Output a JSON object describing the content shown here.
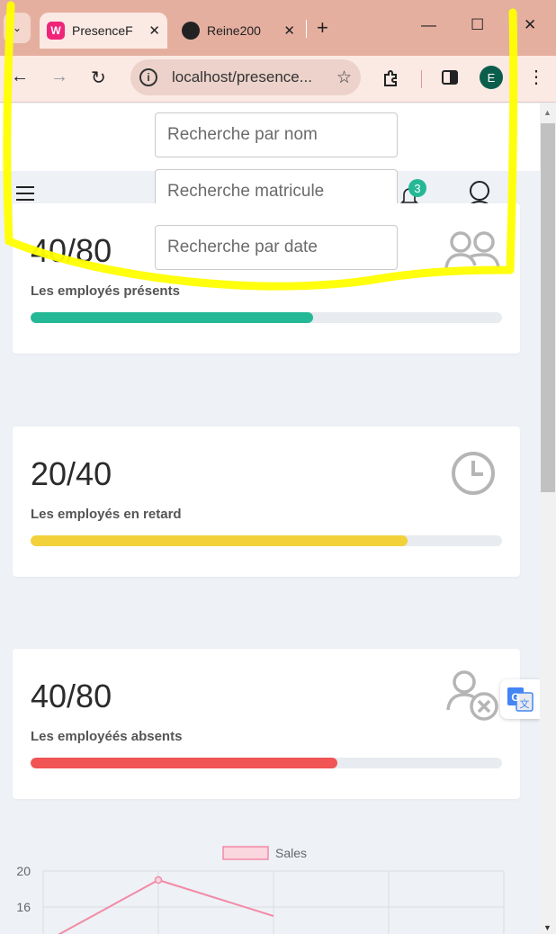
{
  "browser": {
    "tabs": [
      {
        "title": "PresenceF",
        "close": "✕"
      },
      {
        "title": "Reine200",
        "close": "✕"
      }
    ],
    "new_tab": "+",
    "window": {
      "minimize": "—",
      "maximize": "☐",
      "close": "✕"
    },
    "url": "localhost/presence...",
    "profile_initial": "E",
    "wasm_fav": "W"
  },
  "search": {
    "name_placeholder": "Recherche par nom",
    "matricule_placeholder": "Recherche matricule",
    "date_placeholder": "Recherche par date"
  },
  "header": {
    "notification_count": "3"
  },
  "cards": [
    {
      "value": "40/80",
      "label": "Les employés présents",
      "progress": 0.6,
      "color": "#25b896",
      "icon": "users-icon"
    },
    {
      "value": "20/40",
      "label": "Les employés en retard",
      "progress": 0.8,
      "color": "#f2d13a",
      "icon": "clock-icon"
    },
    {
      "value": "40/80",
      "label": "Les employéés absents",
      "progress": 0.65,
      "color": "#f05454",
      "icon": "user-remove-icon"
    }
  ],
  "chart_data": {
    "type": "line",
    "series": [
      {
        "name": "Sales",
        "color": "#f28aa6",
        "values": [
          12,
          19,
          15
        ]
      }
    ],
    "y_ticks": [
      20,
      16
    ],
    "ylim": [
      0,
      20
    ],
    "grid": true,
    "legend_position": "top"
  }
}
